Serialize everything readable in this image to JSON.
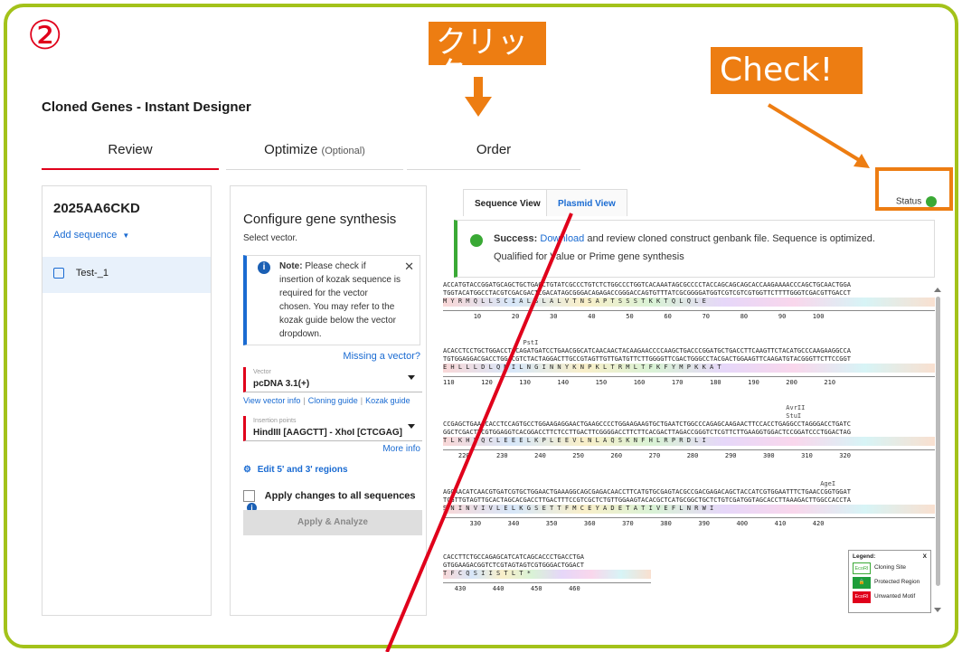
{
  "annotations": {
    "step_number": "②",
    "click_callout": "クリック",
    "check_callout": "Check!",
    "callout_color": "#ed7d12",
    "frame_color": "#a3c21a",
    "arrow_color": "#e0001b"
  },
  "app": {
    "title": "Cloned Genes - Instant Designer"
  },
  "tabs": [
    {
      "label": "Review",
      "suffix": ""
    },
    {
      "label": "Optimize",
      "suffix": "(Optional)"
    },
    {
      "label": "Order",
      "suffix": ""
    }
  ],
  "sidebar": {
    "sequence_id": "2025AA6CKD",
    "add_sequence": "Add sequence",
    "items": [
      {
        "label": "Test-_1"
      }
    ]
  },
  "configure": {
    "title": "Configure gene synthesis",
    "select_vector": "Select vector.",
    "note_label": "Note:",
    "note_text": "Please check if insertion of kozak sequence is required for the vector chosen. You may refer to the kozak guide below the vector dropdown.",
    "missing_vector": "Missing a vector?",
    "vector_label": "Vector",
    "vector_value": "pcDNA 3.1(+)",
    "view_vector_info": "View vector info",
    "cloning_guide": "Cloning guide",
    "kozak_guide": "Kozak guide",
    "insertion_label": "Insertion points",
    "insertion_value": "HindIII [AAGCTT] - XhoI [CTCGAG]",
    "more_info": "More info",
    "edit_regions": "Edit 5' and 3' regions",
    "apply_all": "Apply changes to all sequences",
    "apply_analyze": "Apply & Analyze"
  },
  "viewer": {
    "tab_sequence": "Sequence View",
    "tab_plasmid": "Plasmid View",
    "status_label": "Status",
    "success_label": "Success:",
    "success_link": "Download",
    "success_text": " and review cloned construct genbank file. Sequence is optimized.",
    "success_text2": "Qualified for Value or Prime gene synthesis",
    "blocks": [
      {
        "site": "",
        "top": "ACCATGTACCGGATGCAGCTGCTGAGCTGTATCGCCCTGTCTCTGGCCCTGGTCACAAATAGCGCCCCTACCAGCAGCAGCACCAAGAAAACCCAGCTGCAACTGGA",
        "bottom": "TGGTACATGGCCTACGTCGACGACTCGACATAGCGGGACAGAGACCGGGACCAGTGTTTATCGCGGGGATGGTCGTCGTCGTGGTTCTTTTGGGTCGACGTTGACCT",
        "aa": "M Y R M Q L L S C I A L S L A L V T N S A P T S S S T K K T Q L Q L E",
        "ticks": "        10        20        30        40        50        60        70        80        90       100"
      },
      {
        "site": "                     PstI",
        "top": "ACACCTCCTGCTGGACCTGCAGATGATCCTGAACGGCATCAACAACTACAAGAACCCCAAGCTGACCCGGATGCTGACCTTCAAGTTCTACATGCCCAAGAAGGCCA",
        "bottom": "TGTGGAGGACGACCTGGACGTCTACTAGGACTTGCCGTAGTTGTTGATGTTCTTGGGGTTCGACTGGGCCTACGACTGGAAGTTCAAGATGTACGGGTTCTTCCGGT",
        "aa": "E H L L L D L Q M I L N G I N N Y K N P K L T R M L T F K F Y M P K K A T",
        "ticks": "110       120       130       140       150       160       170       180       190       200       210"
      },
      {
        "site": "                                                                                          AvrII\n                                                                                          StuI",
        "top": "CCGAGCTGAAGCACCTCCAGTGCCTGGAAGAGGAACTGAAGCCCCTGGAAGAAGTGCTGAATCTGGCCCAGAGCAAGAACTTCCACCTGAGGCCTAGGGACCTGATC",
        "bottom": "GGCTCGACTTCGTGGAGGTCACGGACCTTCTCCTTGACTTCGGGGACCTTCTTCACGACTTAGACCGGGTCTCGTTCTTGAAGGTGGACTCCGGATCCCTGGACTAG",
        "aa": "T L K H L Q C L E E E L K P L E E V L N L A Q S K N F H L R P R D L I",
        "ticks": "    220       230       240       250       260       270       280       290       300       310       320"
      },
      {
        "site": "                                                                                                   AgeI",
        "top": "AGCAACATCAACGTGATCGTGCTGGAACTGAAAGGCAGCGAGACAACCTTCATGTGCGAGTACGCCGACGAGACAGCTACCATCGTGGAATTTCTGAACCGGTGGAT",
        "bottom": "TCGTTGTAGTTGCACTAGCACGACCTTGACTTTCCGTCGCTCTGTTGGAAGTACACGCTCATGCGGCTGCTCTGTCGATGGTAGCACCTTAAAGACTTGGCCACCTA",
        "aa": "S N I N V I V L E L K G S E T T F M C E Y A D E T A T I V E F L N R W I",
        "ticks": "       330       340       350       360       370       380       390       400       410       420"
      },
      {
        "site": "",
        "top": "CACCTTCTGCCAGAGCATCATCAGCACCCTGACCTGA",
        "bottom": "GTGGAAGACGGTCTCGTAGTAGTCGTGGGACTGGACT",
        "aa": "T F C Q S I I S T L T *",
        "ticks": "   430       440       450       460"
      }
    ],
    "legend": {
      "title": "Legend:",
      "close": "X",
      "cloning_site": "Cloning Site",
      "protected_region": "Protected Region",
      "unwanted_motif": "Unwanted Motif",
      "swatch_label": "EcoRI"
    }
  }
}
